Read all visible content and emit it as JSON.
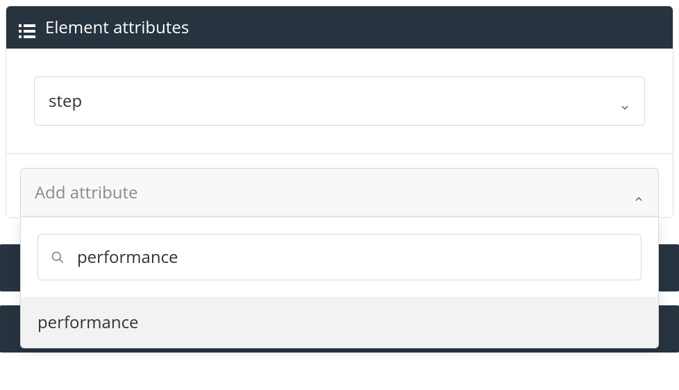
{
  "header": {
    "title": "Element attributes"
  },
  "primarySelect": {
    "value": "step"
  },
  "addAttribute": {
    "placeholder": "Add attribute",
    "searchValue": "performance",
    "options": [
      "performance"
    ]
  }
}
